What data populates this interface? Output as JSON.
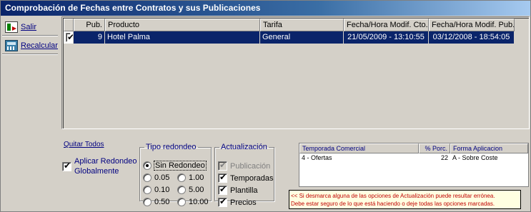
{
  "window": {
    "title": "Comprobación de Fechas entre Contratos y sus Publicaciones"
  },
  "toolbar": {
    "exit_label": "Salir",
    "recalc_label": "Recalcular"
  },
  "grid": {
    "columns": [
      "",
      "Pub.",
      "Producto",
      "Tarifa",
      "Fecha/Hora Modif. Cto.",
      "Fecha/Hora Modif. Pub."
    ],
    "rows": [
      {
        "checked": true,
        "pub": "9",
        "producto": "Hotel Palma",
        "tarifa": "General",
        "fecha_cto": "21/05/2009 - 13:10:55",
        "fecha_pub": "03/12/2008 - 18:54:05"
      }
    ]
  },
  "options": {
    "quitar_todos": "Quitar Todos",
    "aplicar_label": "Aplicar Redondeo Globalmente",
    "aplicar_checked": true
  },
  "redondeo": {
    "legend": "Tipo redondeo",
    "selected": "Sin Redondeo",
    "options": [
      "Sin Redondeo",
      "0.05",
      "1.00",
      "0.10",
      "5.00",
      "0.50",
      "10.00"
    ]
  },
  "actualizacion": {
    "legend": "Actualización",
    "items": [
      {
        "label": "Publicación",
        "checked": true,
        "disabled": true
      },
      {
        "label": "Temporadas",
        "checked": true,
        "disabled": false
      },
      {
        "label": "Plantilla",
        "checked": true,
        "disabled": false
      },
      {
        "label": "Precios",
        "checked": true,
        "disabled": false
      }
    ]
  },
  "temporadas": {
    "columns": [
      "Temporada Comercial",
      "% Porc.",
      "Forma Aplicacion"
    ],
    "rows": [
      {
        "temporada": "4 - Ofertas",
        "porc": "22",
        "forma": "A - Sobre Coste"
      }
    ]
  },
  "warning": {
    "line1": "<< Si desmarca alguna de las opciones de Actualización puede resultar errónea.",
    "line2": "Debe estar seguro de lo que está haciendo o deje todas las opciones marcadas."
  }
}
